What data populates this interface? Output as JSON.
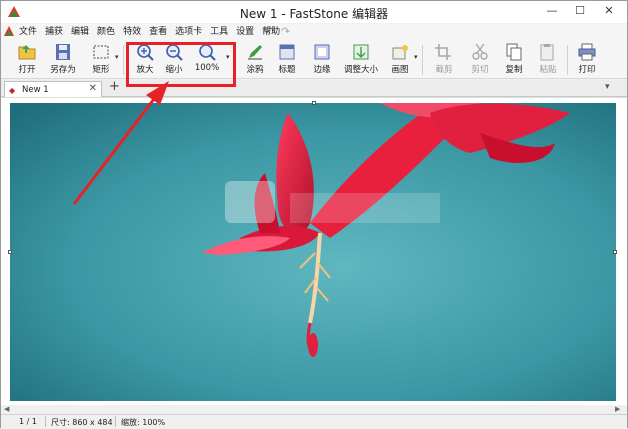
{
  "window": {
    "title": "New 1 - FastStone 编辑器",
    "minimize": "—",
    "maximize": "☐",
    "close": "✕"
  },
  "menubar": {
    "items": [
      "文件",
      "捕获",
      "编辑",
      "颜色",
      "特效",
      "查看",
      "选项卡",
      "工具",
      "设置",
      "帮助"
    ],
    "undo": "↶",
    "redo": "↷"
  },
  "toolbar": {
    "open": "打开",
    "save_as": "另存为",
    "rectangle": "矩形",
    "zoom_in": "放大",
    "zoom_out": "缩小",
    "zoom_100": "100%",
    "draw": "涂鸦",
    "caption": "标题",
    "edge": "边缘",
    "resize": "调整大小",
    "canvas": "画图",
    "crop": "截剪",
    "cut": "剪切",
    "copy": "复制",
    "paste": "粘贴",
    "print": "打印"
  },
  "tabs": {
    "items": [
      {
        "label": "New 1"
      }
    ],
    "close": "✕",
    "add": "+",
    "more": "▾"
  },
  "status": {
    "page": "1 / 1",
    "size": "尺寸: 860 x 484",
    "zoom": "缩放: 100%"
  },
  "colors": {
    "annotation": "#e82028",
    "photo_teal": "#3b97a3",
    "flower": "#e0203e"
  },
  "icons": {
    "open": "folder-open-icon",
    "save_as": "floppy-disk-icon",
    "rectangle": "rectangle-select-icon",
    "zoom_in": "zoom-in-icon",
    "zoom_out": "zoom-out-icon",
    "zoom_100": "zoom-actual-icon",
    "draw": "draw-icon",
    "caption": "caption-icon",
    "edge": "edge-icon",
    "resize": "resize-icon",
    "canvas": "canvas-icon",
    "crop": "crop-icon",
    "cut": "scissors-icon",
    "copy": "copy-icon",
    "paste": "paste-icon",
    "print": "printer-icon"
  }
}
